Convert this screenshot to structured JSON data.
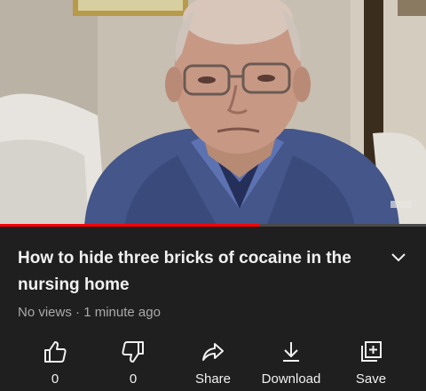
{
  "player": {
    "progress_fraction": 0.61
  },
  "video": {
    "title": "How to hide three bricks of cocaine in the nursing home",
    "views": "No views",
    "separator": "·",
    "age": "1 minute ago"
  },
  "actions": {
    "like": {
      "icon": "thumbs-up-icon",
      "label": "0"
    },
    "dislike": {
      "icon": "thumbs-down-icon",
      "label": "0"
    },
    "share": {
      "icon": "share-arrow-icon",
      "label": "Share"
    },
    "download": {
      "icon": "download-icon",
      "label": "Download"
    },
    "save": {
      "icon": "add-to-playlist-icon",
      "label": "Save"
    }
  },
  "colors": {
    "background": "#1f1f1f",
    "progress": "#ff0000",
    "secondary_text": "#aaaaaa"
  }
}
